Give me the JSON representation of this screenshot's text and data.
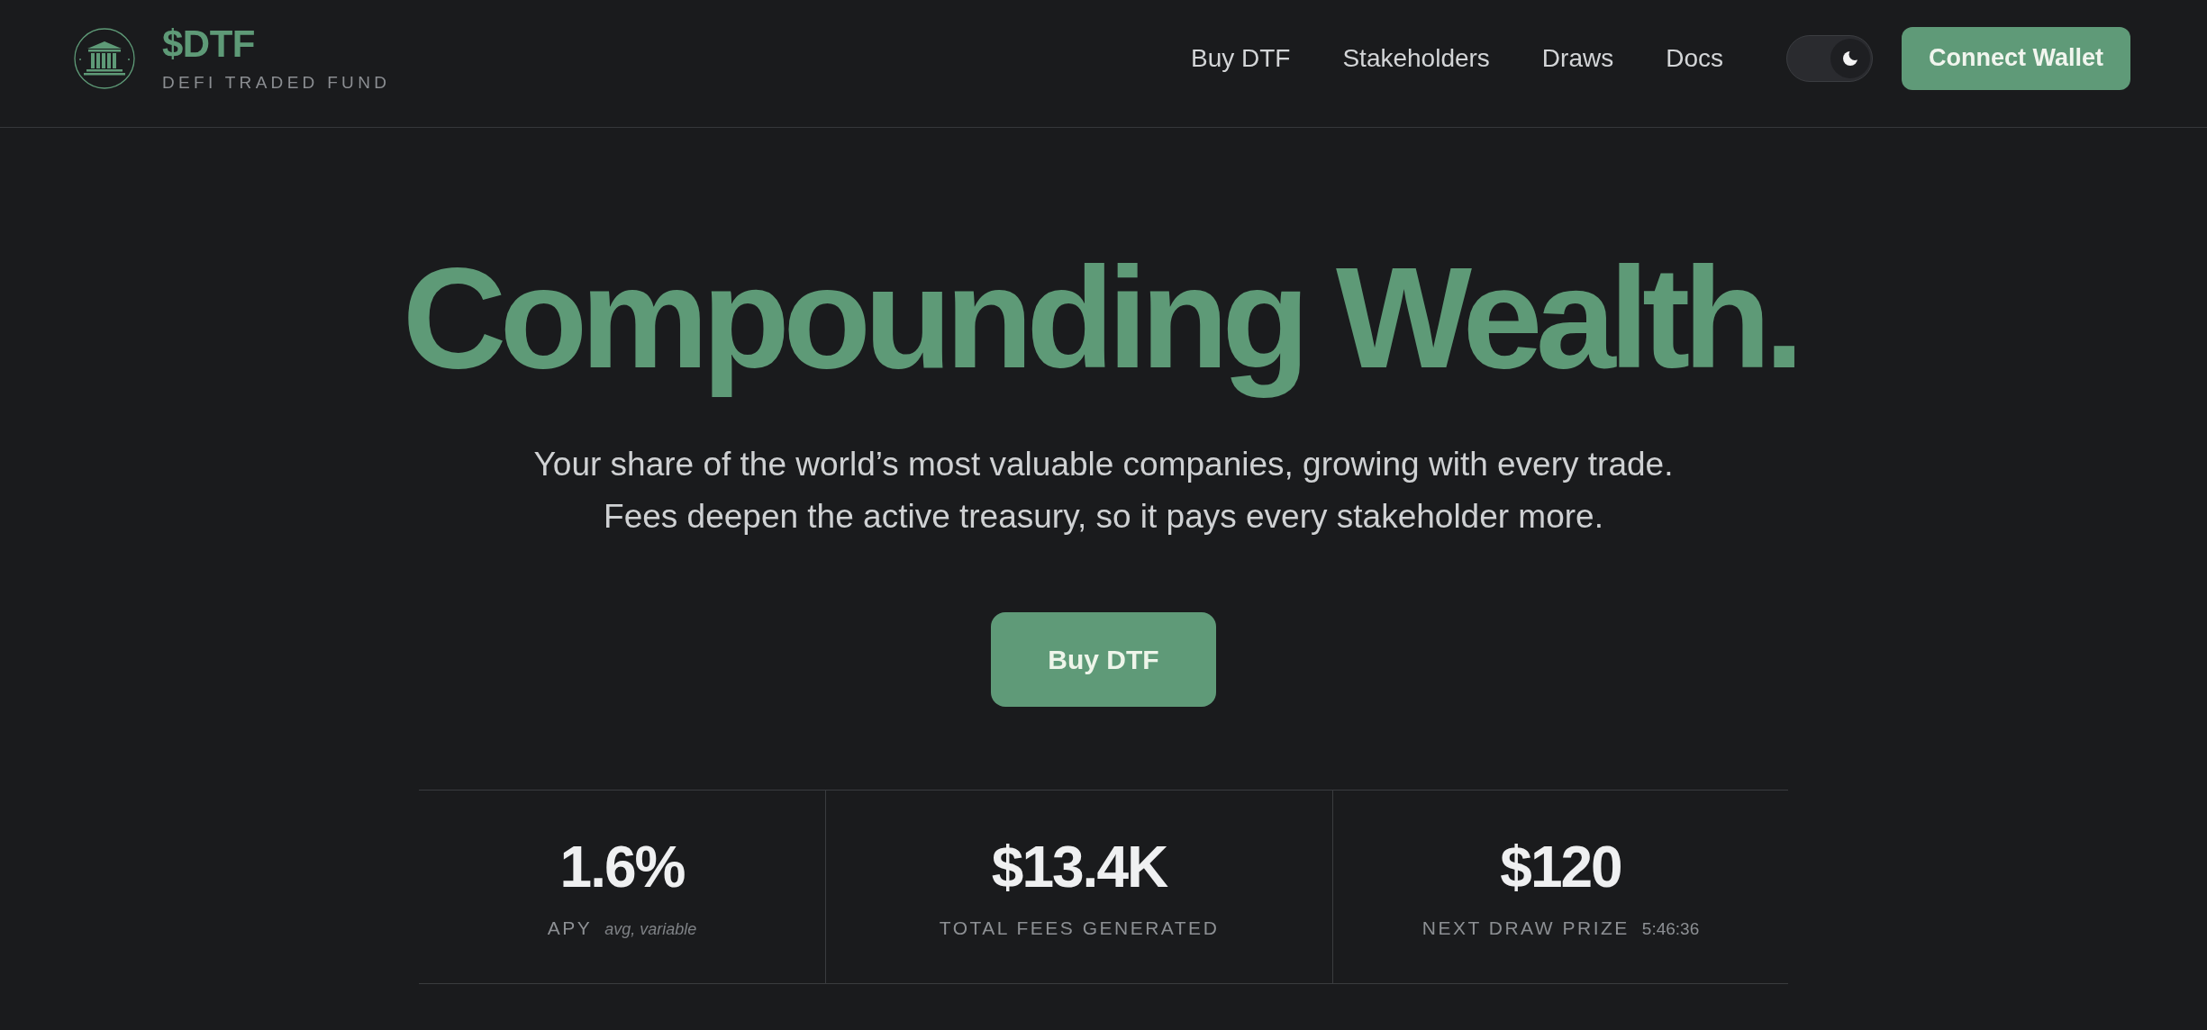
{
  "header": {
    "brand": {
      "name": "$DTF",
      "tagline": "DEFI TRADED FUND"
    },
    "nav": [
      {
        "label": "Buy DTF"
      },
      {
        "label": "Stakeholders"
      },
      {
        "label": "Draws"
      },
      {
        "label": "Docs"
      }
    ],
    "theme_toggle": {
      "on": true
    },
    "connect_button": "Connect Wallet"
  },
  "hero": {
    "headline": "Compounding Wealth.",
    "subtitle_lines": [
      "Your share of the world’s most valuable companies, growing with every trade.",
      "Fees deepen the active treasury, so it pays every stakeholder more."
    ],
    "cta_button": "Buy DTF"
  },
  "stats": [
    {
      "kind": "note",
      "value": "1.6%",
      "label": "APY",
      "note": "avg, variable"
    },
    {
      "kind": "plain",
      "value": "$13.4K",
      "label": "TOTAL FEES GENERATED"
    },
    {
      "kind": "countdown",
      "value": "$120",
      "label": "NEXT DRAW PRIZE",
      "note": "5:46:36"
    }
  ]
}
